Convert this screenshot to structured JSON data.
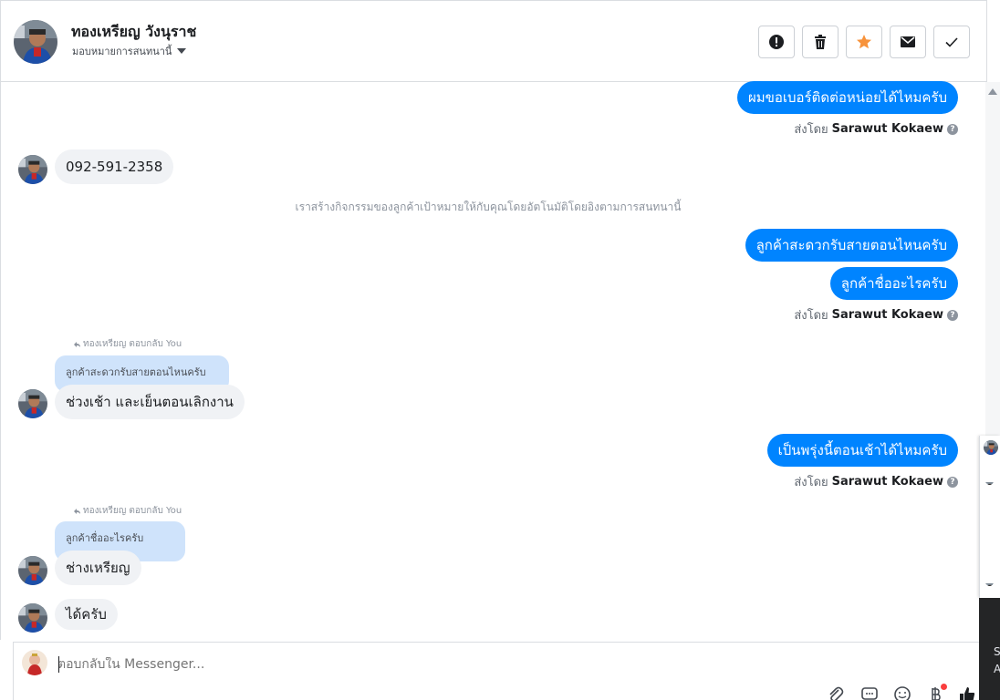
{
  "header": {
    "contact_name": "ทองเหรียญ วังนุราช",
    "assign_label": "มอบหมายการสนทนานี้",
    "buttons": [
      {
        "name": "mark-spam-button",
        "icon": "exclamation-icon"
      },
      {
        "name": "delete-button",
        "icon": "trash-icon"
      },
      {
        "name": "star-button",
        "icon": "star-icon",
        "color": "#f7923a"
      },
      {
        "name": "mark-unread-button",
        "icon": "envelope-icon"
      },
      {
        "name": "mark-done-button",
        "icon": "checkmark-icon"
      }
    ]
  },
  "messages": {
    "m1": "ผมขอเบอร์ติดต่อหน่อยได้ไหมครับ",
    "m2": "092-591-2358",
    "system": "เราสร้างกิจกรรมของลูกค้าเป้าหมายให้กับคุณโดยอัตโนมัติโดยอิงตามการสนทนานี้",
    "m3": "ลูกค้าสะดวกรับสายตอนไหนครับ",
    "m4": "ลูกค้าชื่ออะไรครับ",
    "m5_reply_meta": "ทองเหรียญ ตอบกลับ You",
    "m5_quote": "ลูกค้าสะดวกรับสายตอนไหนครับ",
    "m5": "ช่วงเช้า และเย็นตอนเลิกงาน",
    "m6": "เป็นพรุ่งนี้ตอนเช้าได้ไหมครับ",
    "m7_reply_meta": "ทองเหรียญ ตอบกลับ You",
    "m7_quote": "ลูกค้าชื่ออะไรครับ",
    "m7": "ช่างเหรียญ",
    "m8": "ได้ครับ"
  },
  "sent_by": {
    "prefix": "ส่งโดย",
    "agent": "Sarawut Kokaew"
  },
  "composer": {
    "placeholder": "ตอบกลับใน Messenger..."
  },
  "side_popup": {
    "line1": "S",
    "line2": "A"
  },
  "colors": {
    "outgoing_bubble": "#0084ff",
    "incoming_bubble": "#f0f2f5",
    "quote_bubble": "#cfe3fb",
    "star": "#f7923a"
  }
}
